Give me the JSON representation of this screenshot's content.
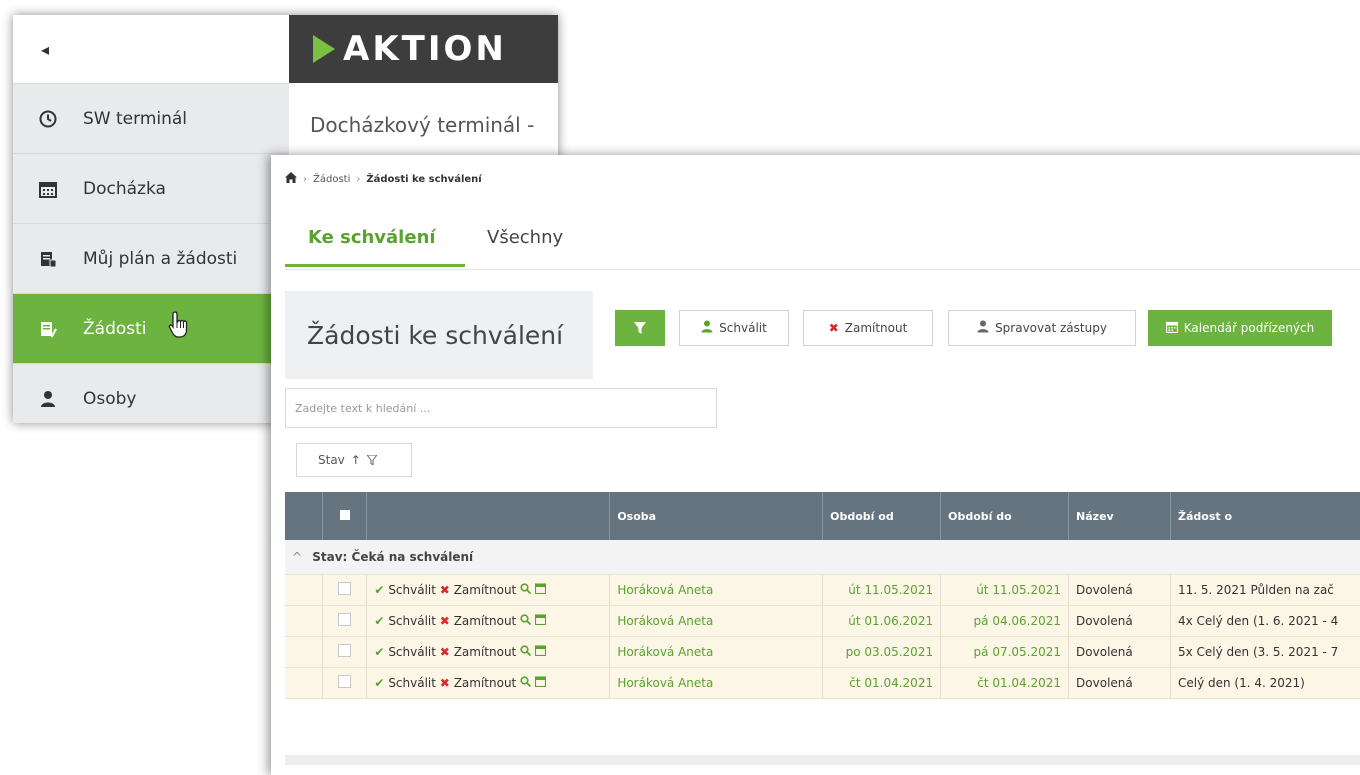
{
  "sidebar": {
    "back_label": "◂",
    "items": [
      {
        "label": "SW terminál",
        "icon": "clock-icon"
      },
      {
        "label": "Docházka",
        "icon": "calendar-icon"
      },
      {
        "label": "Můj plán a žádosti",
        "icon": "plan-icon"
      },
      {
        "label": "Žádosti",
        "icon": "requests-icon",
        "active": true
      },
      {
        "label": "Osoby",
        "icon": "person-icon"
      }
    ]
  },
  "brand": {
    "logo_text": "AKTION",
    "accent": "#6cb33f",
    "header_bg": "#3d3d3d"
  },
  "background_page": {
    "title": "Docházkový terminál -"
  },
  "breadcrumb": {
    "level1": "Žádosti",
    "level2": "Žádosti ke schválení"
  },
  "tabs": [
    {
      "label": "Ke schválení",
      "active": true
    },
    {
      "label": "Všechny",
      "active": false
    }
  ],
  "main": {
    "title": "Žádosti ke schválení"
  },
  "toolbar": {
    "approve_label": "Schválit",
    "reject_label": "Zamítnout",
    "substitutes_label": "Spravovat zástupy",
    "calendar_label": "Kalendář podřízených"
  },
  "search": {
    "placeholder": "Zadejte text k hledání ..."
  },
  "sort_chip": {
    "label": "Stav"
  },
  "table": {
    "columns": {
      "person": "Osoba",
      "from": "Období od",
      "to": "Období do",
      "name": "Název",
      "request": "Žádost o"
    },
    "group_label": "Stav: Čeká na schválení",
    "approve_action": "Schválit",
    "reject_action": "Zamítnout",
    "rows": [
      {
        "person": "Horáková Aneta",
        "from": "út 11.05.2021",
        "to": "út 11.05.2021",
        "name": "Dovolená",
        "request": "11. 5. 2021 Půlden na zač"
      },
      {
        "person": "Horáková Aneta",
        "from": "út 01.06.2021",
        "to": "pá 04.06.2021",
        "name": "Dovolená",
        "request": "4x Celý den (1. 6. 2021 - 4"
      },
      {
        "person": "Horáková Aneta",
        "from": "po 03.05.2021",
        "to": "pá 07.05.2021",
        "name": "Dovolená",
        "request": "5x Celý den (3. 5. 2021 - 7"
      },
      {
        "person": "Horáková Aneta",
        "from": "čt 01.04.2021",
        "to": "čt 01.04.2021",
        "name": "Dovolená",
        "request": "Celý den (1. 4. 2021)"
      }
    ]
  }
}
